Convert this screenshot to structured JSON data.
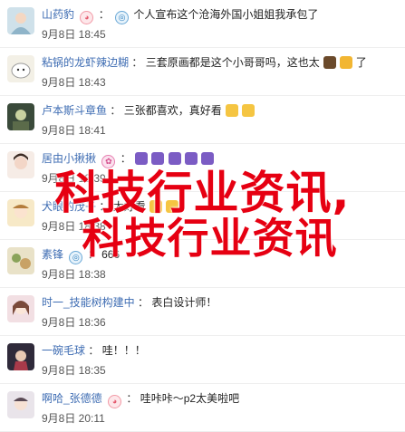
{
  "comments": [
    {
      "user": "山药豹",
      "sep": "：",
      "message": "个人宣布这个沧海外国小姐姐我承包了",
      "time": "9月8日 18:45"
    },
    {
      "user": "粘锅的龙虾辣边糊",
      "sep": "：",
      "message": "三套原画都是这个小哥哥吗，这也太",
      "message_tail": "了",
      "time": "9月8日 18:43"
    },
    {
      "user": "卢本斯斗章鱼",
      "sep": "：",
      "message": "三张都喜欢，真好看",
      "time": "9月8日 18:41"
    },
    {
      "user": "居由小揪揪",
      "sep": "：",
      "message": "",
      "time": "9月8日 18:39"
    },
    {
      "user": "犬眼的茂子",
      "sep": "：",
      "message": "太好看",
      "time": "9月8日 18:38"
    },
    {
      "user": "素锋",
      "sep": "：",
      "message": "666",
      "time": "9月8日 18:38"
    },
    {
      "user": "时一_技能树构建中",
      "sep": "：",
      "message": "表白设计师！",
      "time": "9月8日 18:36"
    },
    {
      "user": "一碗毛球",
      "sep": "：",
      "message": "哇！！！",
      "time": "9月8日 18:35"
    },
    {
      "user": "啊哈_张德德",
      "sep": "：",
      "message": "哇咔咔～p2太美啦吧",
      "time": "9月8日 20:11"
    }
  ],
  "watermark": {
    "line1": "科技行业资讯,",
    "line2": "科技行业资讯"
  },
  "colors": {
    "username": "#3f6db3",
    "watermark": "#e60012",
    "text": "#222222",
    "time": "#555555"
  }
}
